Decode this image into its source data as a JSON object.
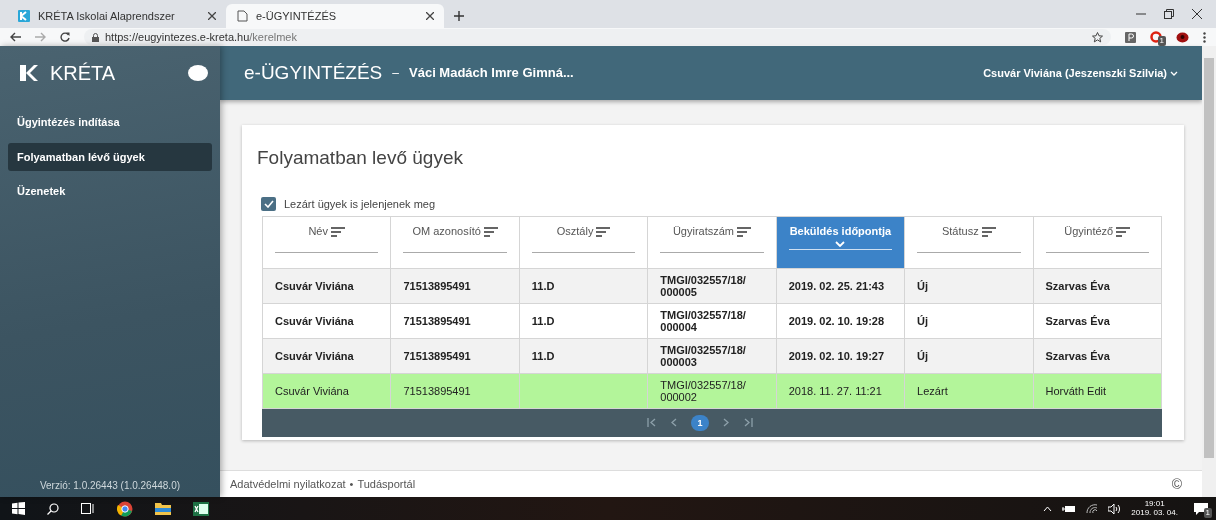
{
  "browser": {
    "tabs": [
      {
        "title": "KRÉTA Iskolai Alaprendszer",
        "selected": false,
        "kind": "app"
      },
      {
        "title": "e-ÜGYINTÉZÉS",
        "selected": true,
        "kind": "page"
      }
    ],
    "url": {
      "host": "https://eugyintezes.e-kreta.hu",
      "path": "/kerelmek"
    },
    "extension_badge": "1"
  },
  "header": {
    "logo": "KRÉTA",
    "title": "e-ÜGYINTÉZÉS",
    "separator": "–",
    "school": "Váci Madách Imre Gimná...",
    "user": "Csuvár Viviána (Jeszenszki Szilvia)"
  },
  "sidebar": {
    "items": [
      {
        "label": "Ügyintézés indítása",
        "selected": false
      },
      {
        "label": "Folyamatban lévő ügyek",
        "selected": true
      },
      {
        "label": "Üzenetek",
        "selected": false
      }
    ],
    "version": "Verzió: 1.0.26443 (1.0.26448.0)"
  },
  "page_title": "Folyamatban levő ügyek",
  "filter": {
    "label": "Lezárt ügyek is jelenjenek meg",
    "checked": true
  },
  "table": {
    "columns": [
      {
        "label": "Név",
        "selected": false
      },
      {
        "label": "OM azonosító",
        "selected": false
      },
      {
        "label": "Osztály",
        "selected": false
      },
      {
        "label": "Ügyiratszám",
        "selected": false
      },
      {
        "label": "Beküldés időpontja",
        "selected": true
      },
      {
        "label": "Státusz",
        "selected": false
      },
      {
        "label": "Ügyintéző",
        "selected": false
      }
    ],
    "rows": [
      {
        "closed": false,
        "cells": [
          "Csuvár Viviána",
          "71513895491",
          "11.D",
          "TMGI/032557/18/ 000005",
          "2019. 02. 25. 21:43",
          "Új",
          "Szarvas Éva"
        ]
      },
      {
        "closed": false,
        "cells": [
          "Csuvár Viviána",
          "71513895491",
          "11.D",
          "TMGI/032557/18/ 000004",
          "2019. 02. 10. 19:28",
          "Új",
          "Szarvas Éva"
        ]
      },
      {
        "closed": false,
        "cells": [
          "Csuvár Viviána",
          "71513895491",
          "11.D",
          "TMGI/032557/18/ 000003",
          "2019. 02. 10. 19:27",
          "Új",
          "Szarvas Éva"
        ]
      },
      {
        "closed": true,
        "cells": [
          "Csuvár Viviána",
          "71513895491",
          "",
          "TMGI/032557/18/ 000002",
          "2018. 11. 27. 11:21",
          "Lezárt",
          "Horváth Edit"
        ]
      }
    ],
    "pages": [
      {
        "label": "1",
        "selected": true
      }
    ]
  },
  "footer": {
    "links": [
      "Adatvédelmi nyilatkozat",
      "Tudásportál"
    ],
    "separator": "•",
    "copyright": "©"
  },
  "taskbar": {
    "time": "19:01",
    "date": "2019. 03. 04.",
    "notification_badge": "1"
  }
}
